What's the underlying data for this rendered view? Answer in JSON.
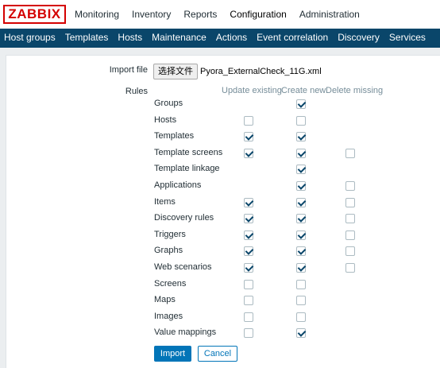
{
  "app": {
    "logo": "ZABBIX"
  },
  "top_nav": [
    "Monitoring",
    "Inventory",
    "Reports",
    "Configuration",
    "Administration"
  ],
  "top_nav_active": "Configuration",
  "sub_nav": [
    "Host groups",
    "Templates",
    "Hosts",
    "Maintenance",
    "Actions",
    "Event correlation",
    "Discovery",
    "Services"
  ],
  "form": {
    "import_file_label": "Import file",
    "file_button_label": "选择文件",
    "file_name": "Pyora_ExternalCheck_11G.xml",
    "rules_label": "Rules",
    "columns": [
      "Update existing",
      "Create new",
      "Delete missing"
    ],
    "rules": [
      {
        "name": "Groups",
        "update": null,
        "create": true,
        "delete": null
      },
      {
        "name": "Hosts",
        "update": false,
        "create": false,
        "delete": null
      },
      {
        "name": "Templates",
        "update": true,
        "create": true,
        "delete": null
      },
      {
        "name": "Template screens",
        "update": true,
        "create": true,
        "delete": false
      },
      {
        "name": "Template linkage",
        "update": null,
        "create": true,
        "delete": null
      },
      {
        "name": "Applications",
        "update": null,
        "create": true,
        "delete": false
      },
      {
        "name": "Items",
        "update": true,
        "create": true,
        "delete": false
      },
      {
        "name": "Discovery rules",
        "update": true,
        "create": true,
        "delete": false
      },
      {
        "name": "Triggers",
        "update": true,
        "create": true,
        "delete": false
      },
      {
        "name": "Graphs",
        "update": true,
        "create": true,
        "delete": false
      },
      {
        "name": "Web scenarios",
        "update": true,
        "create": true,
        "delete": false
      },
      {
        "name": "Screens",
        "update": false,
        "create": false,
        "delete": null
      },
      {
        "name": "Maps",
        "update": false,
        "create": false,
        "delete": null
      },
      {
        "name": "Images",
        "update": false,
        "create": false,
        "delete": null
      },
      {
        "name": "Value mappings",
        "update": false,
        "create": true,
        "delete": null
      }
    ],
    "import_button": "Import",
    "cancel_button": "Cancel"
  }
}
